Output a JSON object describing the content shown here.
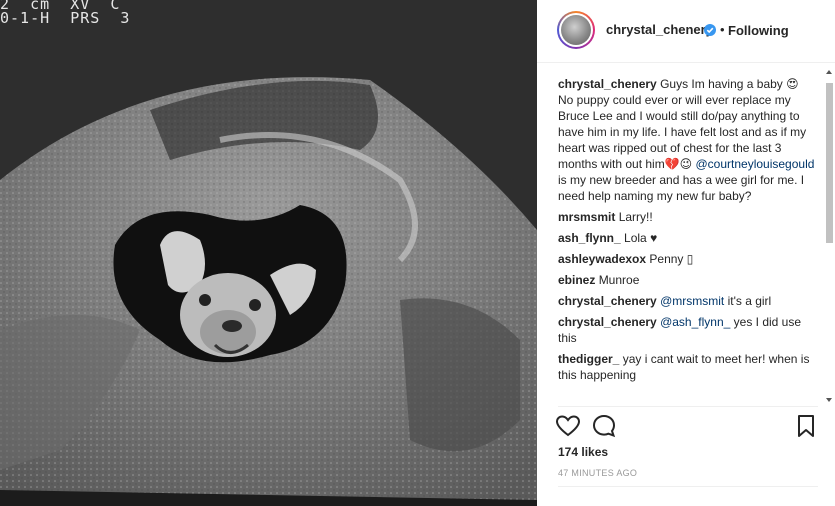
{
  "media": {
    "scan_readout_line1": "2  cm  XV  C",
    "scan_readout_line2": "0-1-H  PRS  3"
  },
  "post_header": {
    "username": "chrystal_chenery",
    "separator": "•",
    "follow_state": "Following"
  },
  "caption": {
    "username": "chrystal_chenery",
    "text_before_mention": "Guys Im having a baby 😍 No puppy could ever or will ever replace my Bruce Lee and I would still do/pay anything to have him in my life. I have felt lost and as if my heart was ripped out of chest for the last 3 months with out him💔😉 ",
    "mention": "@courtneylouisegould",
    "text_after_mention": " is my new breeder and has a wee girl for me. I need help naming my new fur baby?"
  },
  "comments": [
    {
      "user": "mrsmsmit",
      "mention": "",
      "text": "Larry!!"
    },
    {
      "user": "ash_flynn_",
      "mention": "",
      "text": "Lola ♥"
    },
    {
      "user": "ashleywadexox",
      "mention": "",
      "text": "Penny ▯"
    },
    {
      "user": "ebinez",
      "mention": "",
      "text": "Munroe"
    },
    {
      "user": "chrystal_chenery",
      "mention": "@mrsmsmit",
      "text": " it's a girl"
    },
    {
      "user": "chrystal_chenery",
      "mention": "@ash_flynn_",
      "text": " yes I did use this"
    },
    {
      "user": "thedigger_",
      "mention": "",
      "text": "yay i cant wait to meet her! when is this happening"
    }
  ],
  "engagement": {
    "likes": "174 likes",
    "timestamp": "47 MINUTES AGO"
  },
  "icons": {
    "verified": "verified-badge-icon",
    "like": "heart-outline-icon",
    "comment": "comment-bubble-icon",
    "save": "bookmark-icon"
  },
  "colors": {
    "verified": "#3897f0",
    "mention": "#003569",
    "meta": "#999999"
  }
}
